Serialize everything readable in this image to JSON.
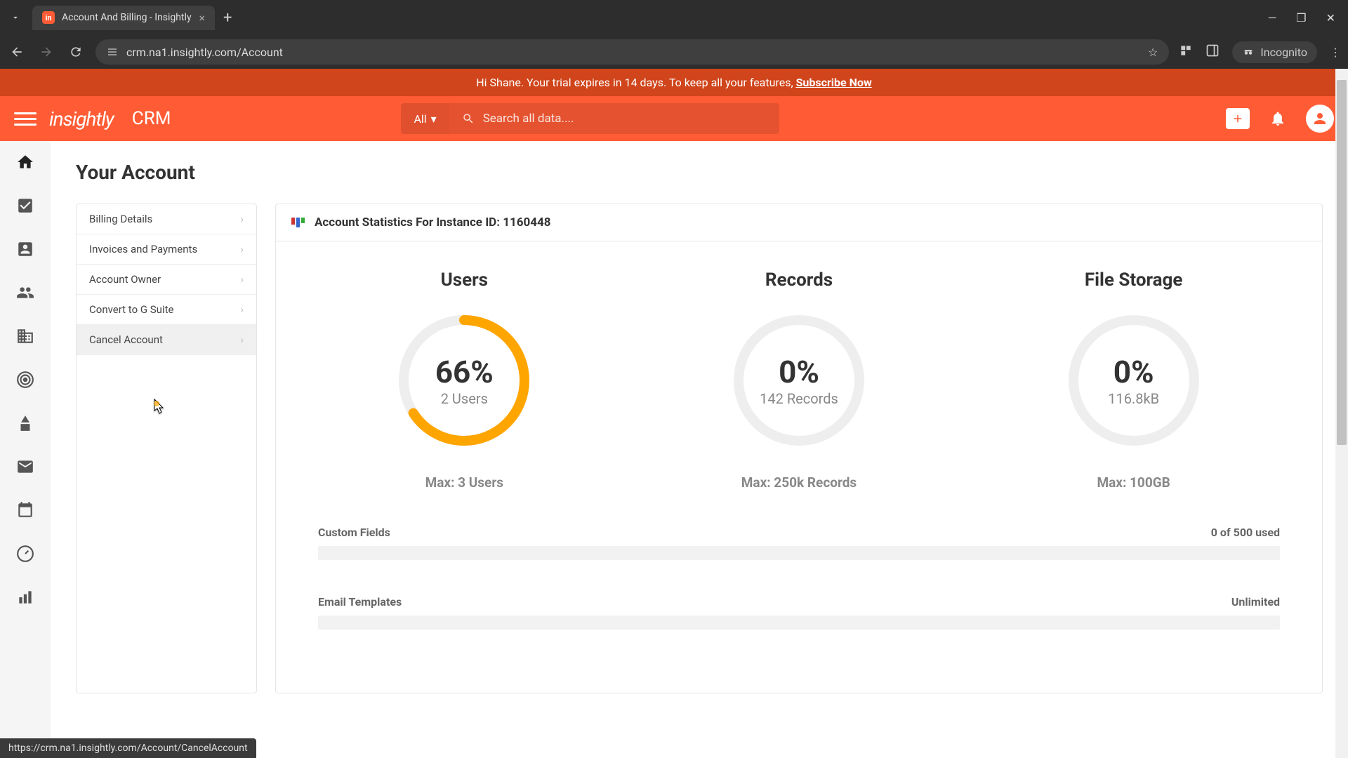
{
  "browser": {
    "tab_title": "Account And Billing - Insightly",
    "url": "crm.na1.insightly.com/Account",
    "incognito": "Incognito"
  },
  "banner": {
    "text_before": "Hi Shane. Your trial expires in 14 days. To keep all your features, ",
    "cta": "Subscribe Now"
  },
  "header": {
    "logo": "insightly",
    "app": "CRM",
    "search_filter": "All",
    "search_placeholder": "Search all data...."
  },
  "page": {
    "title": "Your Account",
    "panel_title": "Account Statistics For Instance ID: 1160448"
  },
  "sidebar": {
    "items": [
      {
        "label": "Billing Details"
      },
      {
        "label": "Invoices and Payments"
      },
      {
        "label": "Account Owner"
      },
      {
        "label": "Convert to G Suite"
      },
      {
        "label": "Cancel Account"
      }
    ]
  },
  "chart_data": {
    "type": "pie",
    "series": [
      {
        "name": "Users",
        "percent": 66,
        "subtitle": "2 Users",
        "max": "Max: 3 Users"
      },
      {
        "name": "Records",
        "percent": 0,
        "subtitle": "142 Records",
        "max": "Max: 250k Records"
      },
      {
        "name": "File Storage",
        "percent": 0,
        "subtitle": "116.8kB",
        "max": "Max: 100GB"
      }
    ],
    "percent_labels": {
      "users": "66%",
      "records": "0%",
      "storage": "0%"
    }
  },
  "bars": [
    {
      "label": "Custom Fields",
      "value": "0 of 500 used"
    },
    {
      "label": "Email Templates",
      "value": "Unlimited"
    }
  ],
  "status_url": "https://crm.na1.insightly.com/Account/CancelAccount"
}
